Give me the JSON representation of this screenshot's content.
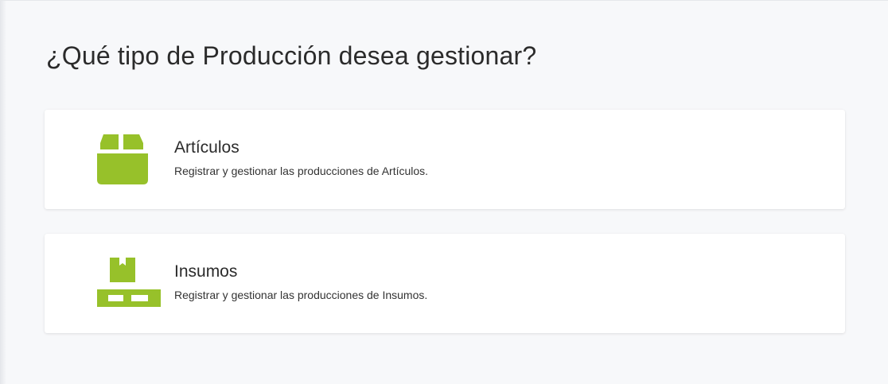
{
  "page": {
    "title": "¿Qué tipo de Producción desea gestionar?"
  },
  "colors": {
    "accent": "#97c12a",
    "background": "#f7f8fa",
    "card": "#ffffff"
  },
  "options": [
    {
      "title": "Artículos",
      "description": "Registrar y gestionar las producciones de Artículos.",
      "icon": "box-icon"
    },
    {
      "title": "Insumos",
      "description": "Registrar y gestionar las producciones de Insumos.",
      "icon": "pallet-icon"
    }
  ]
}
